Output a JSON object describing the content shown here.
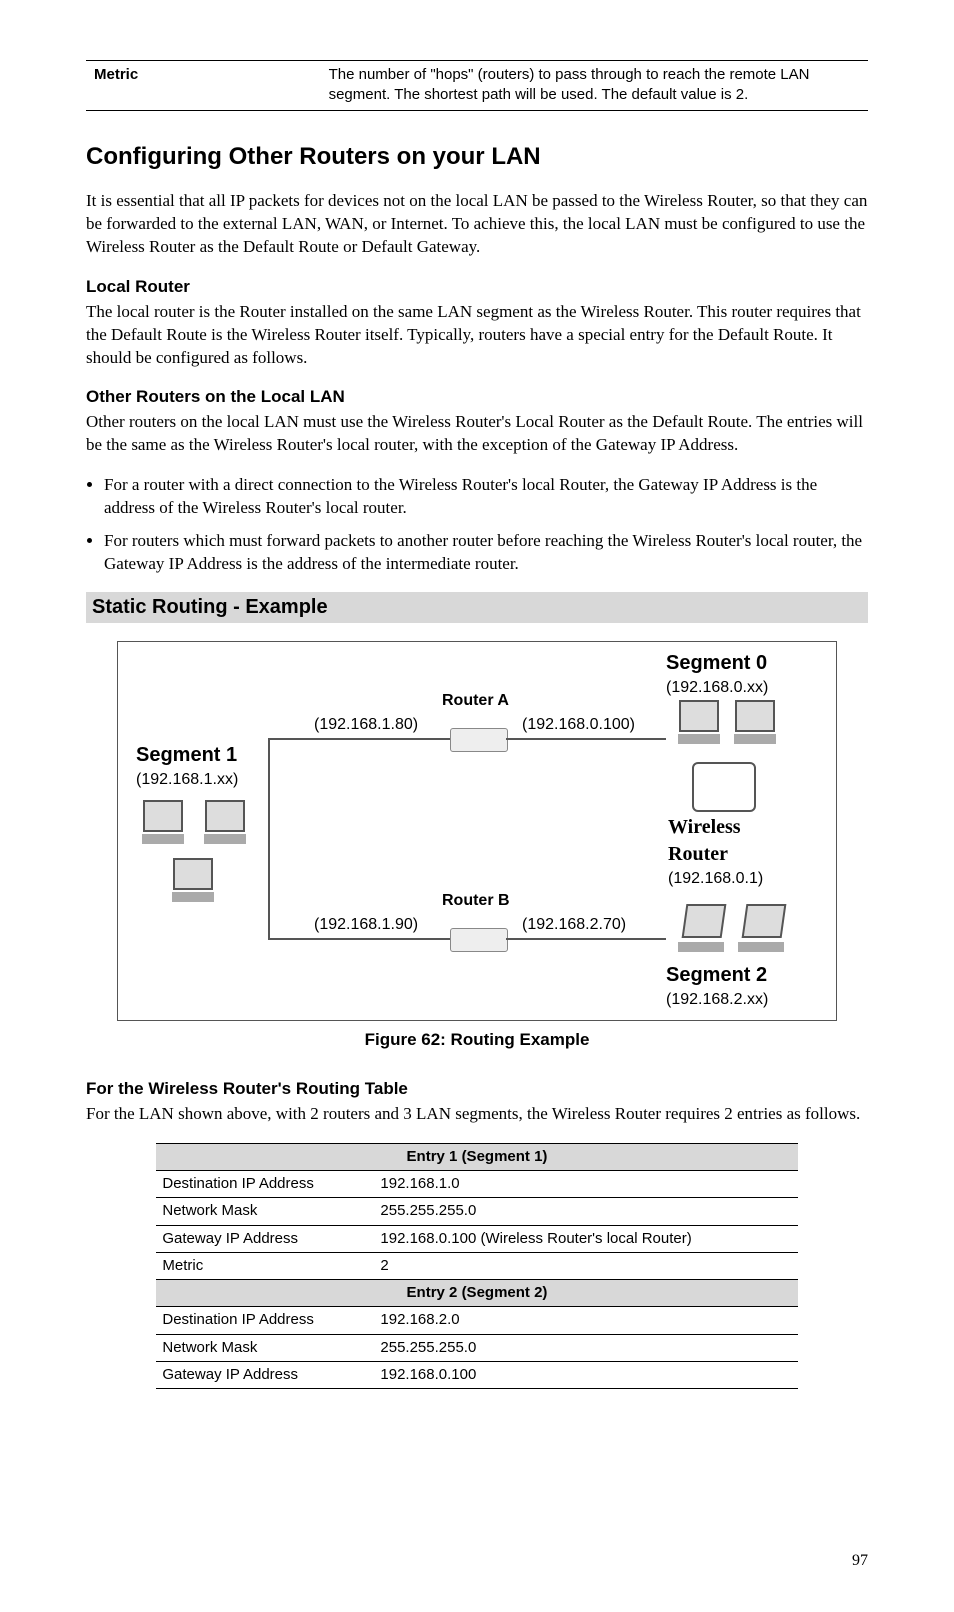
{
  "top_table": {
    "c1": "Metric",
    "c2": "The number of \"hops\" (routers) to pass through to reach the remote LAN segment. The shortest path will be used. The default value is 2."
  },
  "section_title": "Configuring Other Routers on your LAN",
  "intro": "It is essential that all IP packets for devices not on the local LAN be passed to the Wireless Router, so that they can be forwarded to the external LAN, WAN, or Internet. To achieve this, the local LAN must be configured to use the Wireless Router as the Default Route or Default Gateway.",
  "local_router_heading": "Local Router",
  "local_router_text": "The local router is the Router installed on the same LAN segment as the Wireless Router. This router requires that the Default Route is the Wireless Router itself. Typically, routers have a special entry for the Default Route. It should be configured as follows.",
  "other_routers_heading": "Other Routers on the Local LAN",
  "other_routers_text": "Other routers on the local LAN must use the Wireless Router's Local Router as the Default Route. The entries will be the same as the Wireless Router's local router, with the exception of the Gateway IP Address.",
  "bullets": [
    "For a router with a direct connection to the Wireless Router's local Router, the Gateway IP Address is the address of the Wireless Router's local router.",
    "For routers which must forward packets to another router before reaching the Wireless Router's local router, the Gateway IP Address is the address of the intermediate router."
  ],
  "example_heading": "Static Routing - Example",
  "diagram": {
    "seg0": {
      "title": "Segment 0",
      "ip": "(192.168.0.xx)"
    },
    "seg1": {
      "title": "Segment 1",
      "ip": "(192.168.1.xx)"
    },
    "seg2": {
      "title": "Segment 2",
      "ip": "(192.168.2.xx)"
    },
    "routerA": {
      "title": "Router A",
      "left_ip": "(192.168.1.80)",
      "right_ip": "(192.168.0.100)"
    },
    "routerB": {
      "title": "Router B",
      "left_ip": "(192.168.1.90)",
      "right_ip": "(192.168.2.70)"
    },
    "wrouter": {
      "name": "Wireless\nRouter",
      "ip": "(192.168.0.1)"
    }
  },
  "figure_caption": "Figure 62: Routing Example",
  "para_after_fig": "For the Wireless Router's Routing Table",
  "para_after_fig_2": "For the LAN shown above, with 2 routers and 3 LAN segments, the Wireless Router requires 2 entries as follows.",
  "routing_table": {
    "entry1": {
      "header": "Entry 1 (Segment 1)",
      "rows": [
        {
          "k": "Destination IP Address",
          "v": "192.168.1.0"
        },
        {
          "k": "Network Mask",
          "v": "255.255.255.0"
        },
        {
          "k": "Gateway IP Address",
          "v": "192.168.0.100 (Wireless Router's local Router)"
        },
        {
          "k": "Metric",
          "v": "2"
        }
      ]
    },
    "entry2": {
      "header": "Entry 2 (Segment 2)",
      "rows": [
        {
          "k": "Destination IP Address",
          "v": "192.168.2.0"
        },
        {
          "k": "Network Mask",
          "v": "255.255.255.0"
        },
        {
          "k": "Gateway IP Address",
          "v": "192.168.0.100"
        }
      ]
    }
  },
  "page_number": "97"
}
